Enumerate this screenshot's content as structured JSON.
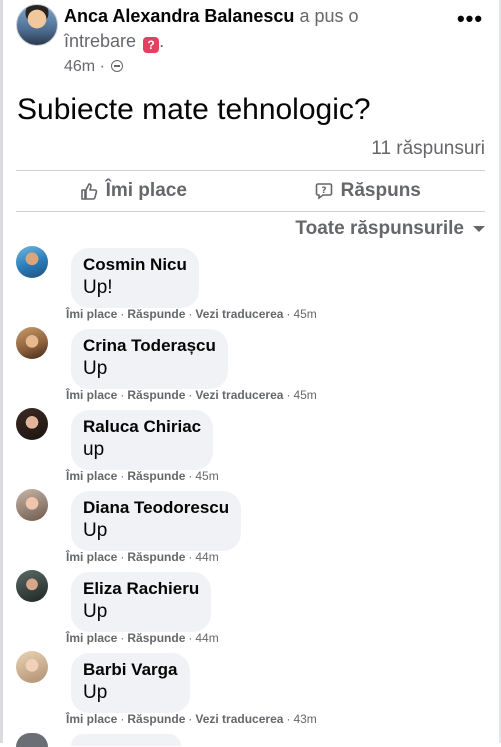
{
  "post": {
    "author": "Anca Alexandra Balanescu",
    "action_text_1": "a pus o",
    "action_text_2": "întrebare",
    "action_suffix": ".",
    "time": "46m",
    "dot": "·",
    "question_badge": "?",
    "title": "Subiecte mate tehnologic?",
    "reply_count": "11 răspunsuri",
    "more_icon": "•••"
  },
  "actions": {
    "like_label": "Îmi place",
    "reply_label": "Răspuns",
    "like_icon": "thumbs-up-icon",
    "reply_icon": "question-bubble-icon"
  },
  "sort": {
    "label": "Toate răspunsurile"
  },
  "comment_actions": {
    "like": "Îmi place",
    "reply": "Răspunde",
    "translate": "Vezi traducerea",
    "sep": "·"
  },
  "comments": [
    {
      "name": "Cosmin Nicu",
      "text": "Up!",
      "time": "45m",
      "translate": true
    },
    {
      "name": "Crina Toderașcu",
      "text": "Up",
      "time": "45m",
      "translate": true
    },
    {
      "name": "Raluca Chiriac",
      "text": "up",
      "time": "45m",
      "translate": false
    },
    {
      "name": "Diana Teodorescu",
      "text": "Up",
      "time": "44m",
      "translate": false
    },
    {
      "name": "Eliza Rachieru",
      "text": "Up",
      "time": "44m",
      "translate": false
    },
    {
      "name": "Barbi Varga",
      "text": "Up",
      "time": "43m",
      "translate": true
    }
  ]
}
